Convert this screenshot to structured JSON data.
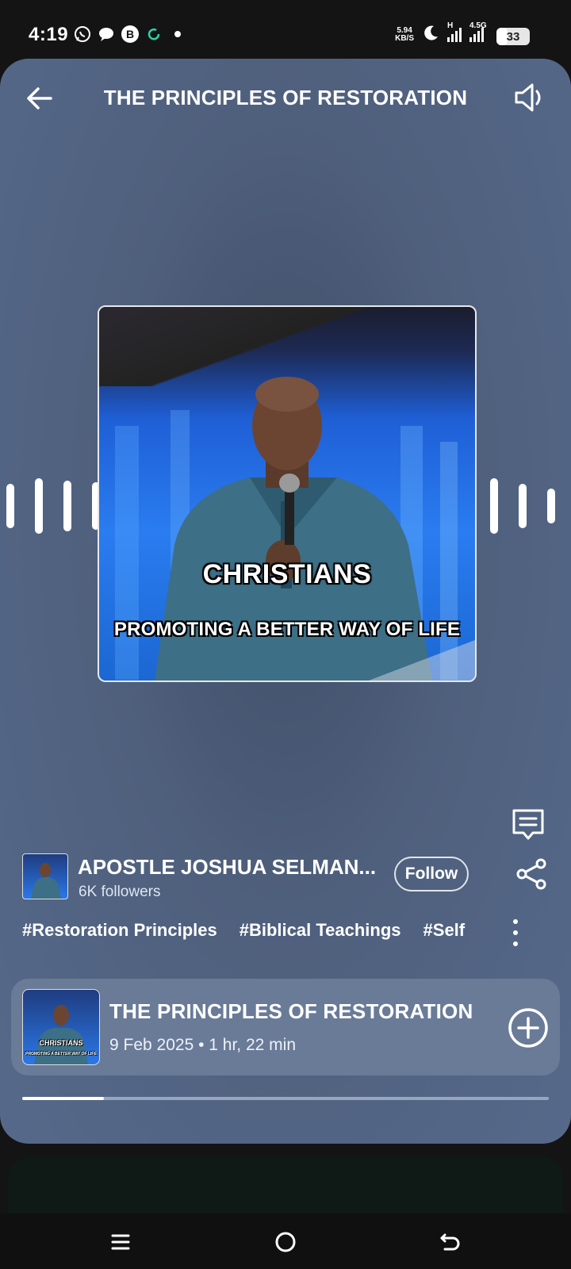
{
  "status_bar": {
    "time": "4:19",
    "net_speed_top": "5.94",
    "net_speed_bottom": "KB/S",
    "network_h": "H",
    "network_45g": "4.5G",
    "battery": "33",
    "battery_level": 0.33
  },
  "header": {
    "title": "THE PRINCIPLES OF RESTORATION"
  },
  "cover": {
    "caption_large": "CHRISTIANS",
    "caption_small": "PROMOTING A BETTER WAY OF LIFE"
  },
  "author": {
    "name": "APOSTLE JOSHUA SELMAN...",
    "followers": "6K followers",
    "follow_label": "Follow"
  },
  "tags": [
    "#Restoration Principles",
    "#Biblical Teachings",
    "#Self"
  ],
  "episode": {
    "title": "THE PRINCIPLES OF RESTORATION",
    "meta": "9 Feb 2025 • 1 hr, 22 min",
    "thumb_caption_large": "CHRISTIANS",
    "thumb_caption_small": "PROMOTING A BETTER WAY OF LIFE"
  },
  "playback": {
    "progress": 0.155
  },
  "colors": {
    "card_bg": "#56698a",
    "episode_card_bg": "#6a7b98",
    "accent_white": "#ffffff"
  },
  "icons": {
    "back": "arrow-left-icon",
    "volume": "speaker-icon",
    "comment": "comment-icon",
    "share": "share-icon",
    "more": "more-vertical-icon",
    "add": "add-circle-icon",
    "nav_menu": "menu-icon",
    "nav_home": "home-circle-icon",
    "nav_back": "back-arrow-icon"
  }
}
